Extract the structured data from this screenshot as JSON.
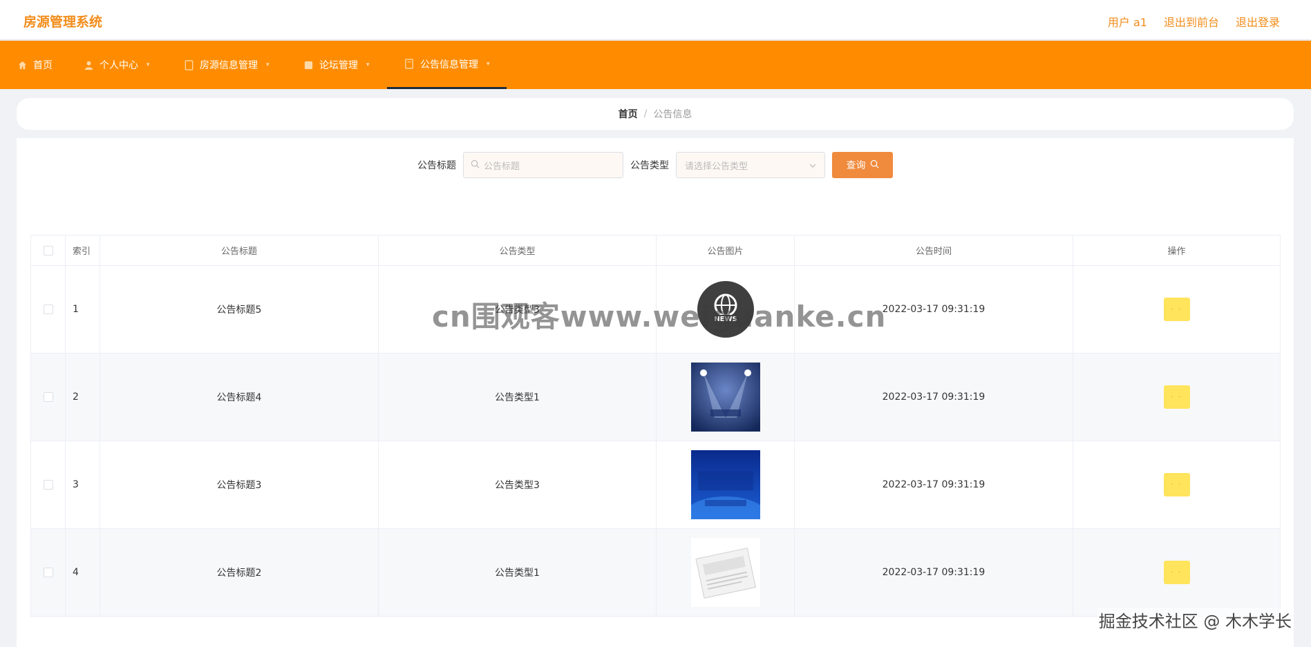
{
  "app": {
    "title": "房源管理系统"
  },
  "top_links": {
    "user": "用户 a1",
    "frontend": "退出到前台",
    "logout": "退出登录"
  },
  "nav": [
    {
      "label": "首页",
      "icon": "home-icon"
    },
    {
      "label": "个人中心",
      "icon": "user-icon"
    },
    {
      "label": "房源信息管理",
      "icon": "document-icon"
    },
    {
      "label": "论坛管理",
      "icon": "forum-icon"
    },
    {
      "label": "公告信息管理",
      "icon": "notice-icon"
    }
  ],
  "breadcrumb": {
    "home": "首页",
    "separator": "/",
    "current": "公告信息"
  },
  "search": {
    "title_label": "公告标题",
    "title_placeholder": "公告标题",
    "type_label": "公告类型",
    "type_placeholder": "请选择公告类型",
    "button": "查询"
  },
  "table": {
    "headers": [
      "索引",
      "公告标题",
      "公告类型",
      "公告图片",
      "公告时间",
      "操作"
    ],
    "rows": [
      {
        "index": "1",
        "title": "公告标题5",
        "type": "公告类型3",
        "image": "news-globe-icon",
        "time": "2022-03-17 09:31:19"
      },
      {
        "index": "2",
        "title": "公告标题4",
        "type": "公告类型1",
        "image": "news-broadcast-image",
        "time": "2022-03-17 09:31:19"
      },
      {
        "index": "3",
        "title": "公告标题3",
        "type": "公告类型3",
        "image": "political-news-image",
        "time": "2022-03-17 09:31:19"
      },
      {
        "index": "4",
        "title": "公告标题2",
        "type": "公告类型1",
        "image": "newspaper-image",
        "time": "2022-03-17 09:31:19"
      }
    ],
    "op_label": "· ·"
  },
  "overlay": {
    "watermark": "cn围观客www.weiguanke.cn",
    "credit": "掘金技术社区 @ 木木学长"
  },
  "colors": {
    "accent": "#ff8c00",
    "title": "#f28c1a",
    "button": "#f08a3c",
    "op_button": "#ffe45c"
  }
}
